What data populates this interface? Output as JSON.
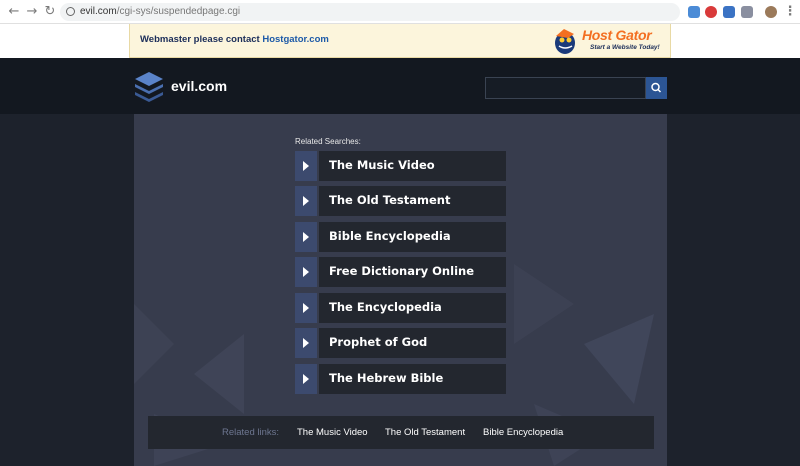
{
  "browser": {
    "url_domain": "evil.com",
    "url_path": "/cgi-sys/suspendedpage.cgi"
  },
  "banner": {
    "text": "Webmaster please contact",
    "link": "Hostgator.com",
    "logo_title": "Host Gator",
    "logo_tagline": "Start a Website Today!"
  },
  "header": {
    "site_name": "evil.com",
    "search_placeholder": ""
  },
  "related": {
    "title": "Related Searches:",
    "items": [
      {
        "label": "The Music Video"
      },
      {
        "label": "The Old Testament"
      },
      {
        "label": "Bible Encyclopedia"
      },
      {
        "label": "Free Dictionary Online"
      },
      {
        "label": "The Encyclopedia"
      },
      {
        "label": "Prophet of God"
      },
      {
        "label": "The Hebrew Bible"
      }
    ]
  },
  "related_links": {
    "label": "Related links:",
    "links": [
      "The Music Video",
      "The Old Testament",
      "Bible Encyclopedia"
    ]
  },
  "colors": {
    "accent": "#2c5594",
    "arrow_block": "#3c4a6e",
    "item_bg": "#23272f",
    "hostgator_orange": "#f36f21"
  }
}
